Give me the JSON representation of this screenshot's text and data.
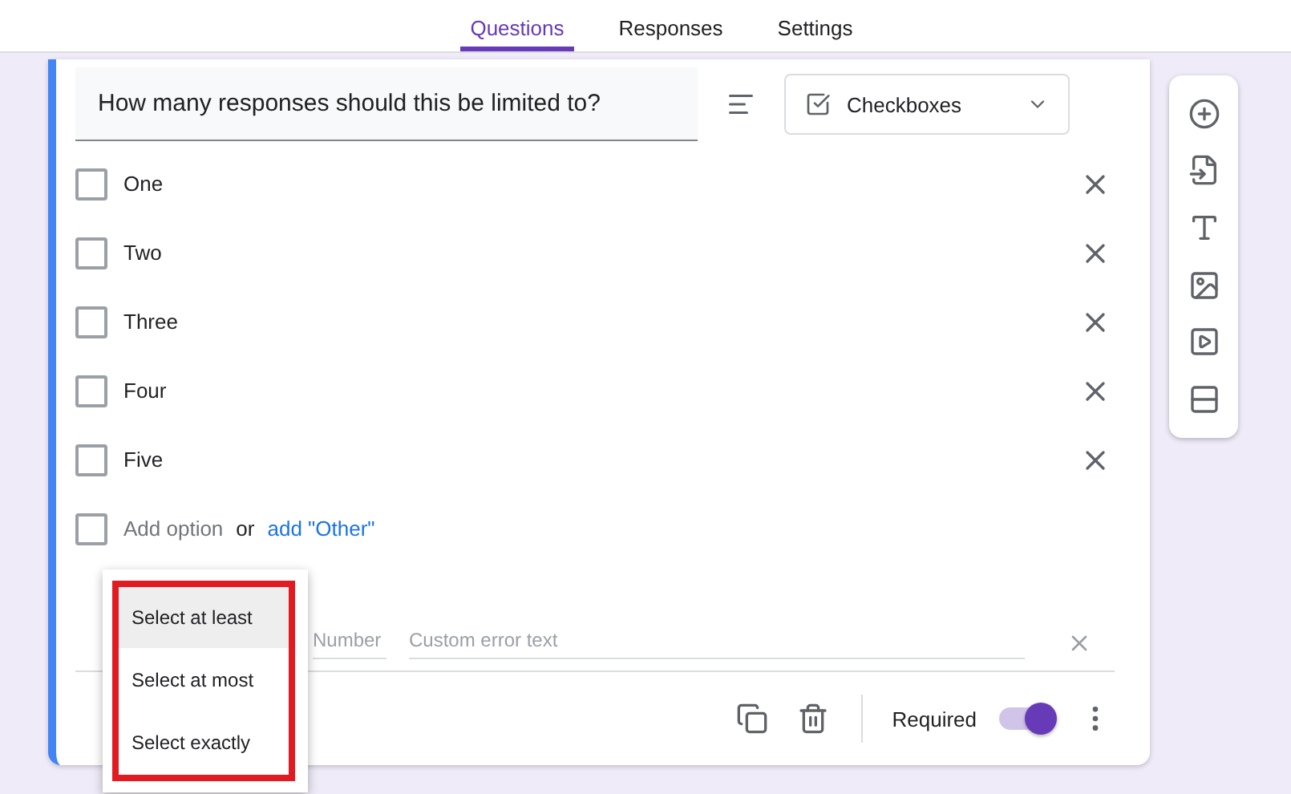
{
  "tabs": [
    {
      "label": "Questions",
      "selected": true
    },
    {
      "label": "Responses",
      "selected": false
    },
    {
      "label": "Settings",
      "selected": false
    }
  ],
  "question": {
    "title": "How many responses should this be limited to?",
    "type": "Checkboxes"
  },
  "options": [
    {
      "label": "One",
      "checked": false
    },
    {
      "label": "Two",
      "checked": false
    },
    {
      "label": "Three",
      "checked": false
    },
    {
      "label": "Four",
      "checked": false
    },
    {
      "label": "Five",
      "checked": false
    }
  ],
  "add_option": {
    "checked": false,
    "label": "Add option",
    "or": "or",
    "other_link": "add \"Other\""
  },
  "validation": {
    "number_placeholder": "Number",
    "error_placeholder": "Custom error text"
  },
  "menu": [
    {
      "label": "Select at least",
      "selected": true
    },
    {
      "label": "Select at most",
      "selected": false
    },
    {
      "label": "Select exactly",
      "selected": false
    }
  ],
  "footer": {
    "required_label": "Required",
    "required": true
  }
}
